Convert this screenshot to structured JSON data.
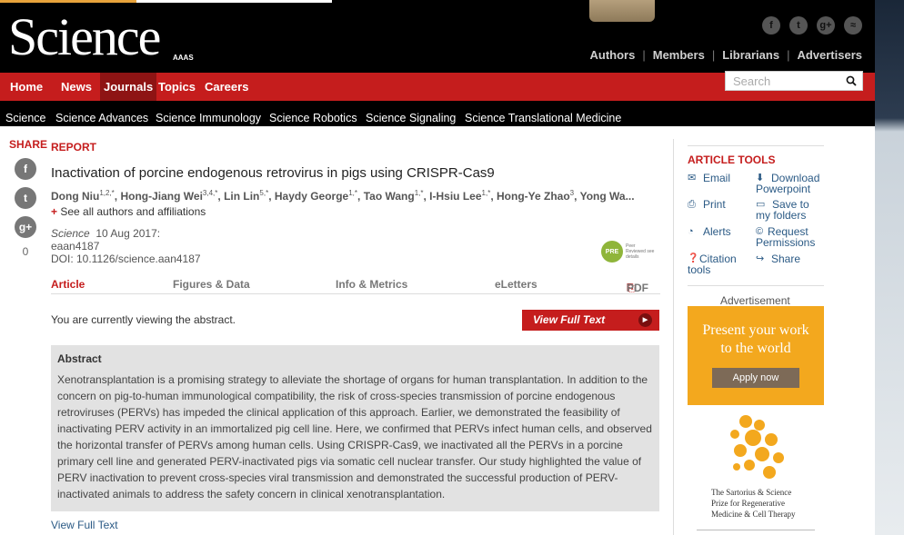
{
  "masthead": {
    "logo": "Science",
    "aaas": "AAAS",
    "social": [
      {
        "icon": "facebook-icon",
        "glyph": "f"
      },
      {
        "icon": "twitter-icon",
        "glyph": "t"
      },
      {
        "icon": "google-plus-icon",
        "glyph": "g+"
      },
      {
        "icon": "rss-icon",
        "glyph": "≈"
      }
    ],
    "links": [
      "Authors",
      "Members",
      "Librarians",
      "Advertisers"
    ]
  },
  "nav": {
    "items": [
      "Home",
      "News",
      "Journals",
      "Topics",
      "Careers"
    ],
    "active": "Journals",
    "search_placeholder": "Search"
  },
  "subnav": [
    "Science",
    "Science Advances",
    "Science Immunology",
    "Science Robotics",
    "Science Signaling",
    "Science Translational Medicine"
  ],
  "share": {
    "label": "SHARE",
    "buttons": [
      {
        "icon": "facebook-icon",
        "glyph": "f"
      },
      {
        "icon": "twitter-icon",
        "glyph": "t"
      },
      {
        "icon": "google-plus-icon",
        "glyph": "g+"
      }
    ],
    "count": "0"
  },
  "article": {
    "type": "REPORT",
    "title": "Inactivation of porcine endogenous retrovirus in pigs using CRISPR-Cas9",
    "authors": [
      {
        "name": "Dong Niu",
        "sup": "1,2,*"
      },
      {
        "name": "Hong-Jiang Wei",
        "sup": "3,4,*"
      },
      {
        "name": "Lin Lin",
        "sup": "5,*"
      },
      {
        "name": "Haydy George",
        "sup": "1,*"
      },
      {
        "name": "Tao Wang",
        "sup": "1,*"
      },
      {
        "name": "I-Hsiu Lee",
        "sup": "1,*"
      },
      {
        "name": "Hong-Ye Zhao",
        "sup": "3"
      },
      {
        "name": "Yong Wa...",
        "sup": ""
      }
    ],
    "see_authors": "See all authors and affiliations",
    "journal": "Science",
    "date": "10 Aug 2017:",
    "eid": "eaan4187",
    "doi": "DOI: 10.1126/science.aan4187",
    "peer_badge": {
      "circle": "PRE",
      "text": "Peer Reviewed see details"
    },
    "tabs": [
      "Article",
      "Figures & Data",
      "Info & Metrics",
      "eLetters",
      "PDF"
    ],
    "viewing_note": "You are currently viewing the abstract.",
    "view_full_text_button": "View Full Text",
    "abstract_title": "Abstract",
    "abstract": "Xenotransplantation is a promising strategy to alleviate the shortage of organs for human transplantation. In addition to the concern on pig-to-human immunological compatibility, the risk of cross-species transmission of porcine endogenous retroviruses (PERVs) has impeded the clinical application of this approach. Earlier, we demonstrated the feasibility of inactivating PERV activity in an immortalized pig cell line. Here, we confirmed that PERVs infect human cells, and observed the horizontal transfer of PERVs among human cells. Using CRISPR-Cas9, we inactivated all the PERVs in a porcine primary cell line and generated PERV-inactivated pigs via somatic cell nuclear transfer. Our study highlighted the value of PERV inactivation to prevent cross-species viral transmission and demonstrated the successful production of PERV-inactivated animals to address the safety concern in clinical xenotransplantation.",
    "view_full_text_link": "View Full Text"
  },
  "tools": {
    "title": "ARTICLE TOOLS",
    "items": [
      {
        "label": "Email",
        "icon": "email-icon",
        "glyph": "✉"
      },
      {
        "label": "Download Powerpoint",
        "icon": "download-icon",
        "glyph": "⬇"
      },
      {
        "label": "Print",
        "icon": "print-icon",
        "glyph": "⎙"
      },
      {
        "label": "Save to my folders",
        "icon": "folder-icon",
        "glyph": "▭"
      },
      {
        "label": "Alerts",
        "icon": "alert-icon",
        "glyph": "◔"
      },
      {
        "label": "Request Permissions",
        "icon": "copyright-icon",
        "glyph": "©"
      },
      {
        "label": "Citation tools",
        "icon": "citation-icon",
        "glyph": "❓"
      },
      {
        "label": "Share",
        "icon": "share-icon",
        "glyph": "↪"
      }
    ]
  },
  "ad": {
    "label": "Advertisement",
    "headline_1": "Present your work",
    "headline_2": "to the world",
    "button": "Apply now",
    "prize_lines": [
      "The Sartorius & Science",
      "Prize for Regenerative",
      "Medicine & Cell Therapy"
    ]
  },
  "colors": {
    "brand_red": "#c51d1d",
    "ad_orange": "#f3a81e",
    "link_blue": "#2b5a85"
  }
}
